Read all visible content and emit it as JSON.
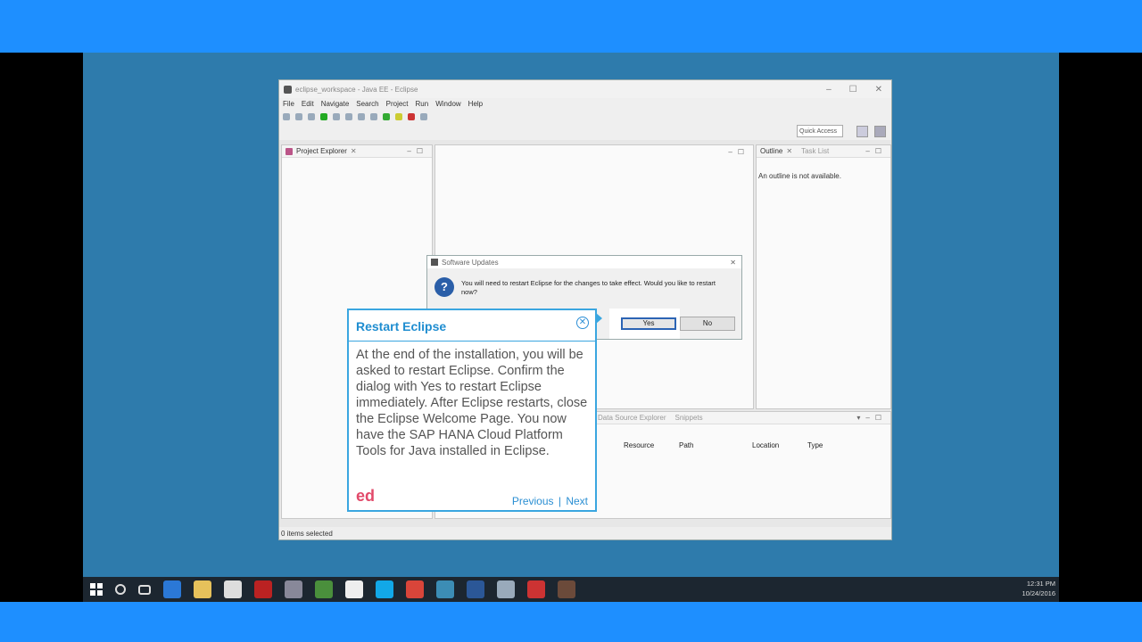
{
  "eclipse": {
    "window_title": "eclipse_workspace - Java EE - Eclipse",
    "menu": [
      "File",
      "Edit",
      "Navigate",
      "Search",
      "Project",
      "Run",
      "Window",
      "Help"
    ],
    "quick_access": "Quick Access",
    "project_explorer": "Project Explorer",
    "outline": "Outline",
    "task_list": "Task List",
    "outline_msg": "An outline is not available.",
    "bottom_tabs": [
      "Data Source Explorer",
      "Snippets"
    ],
    "table_headers": [
      "Resource",
      "Path",
      "Location",
      "Type"
    ],
    "status": "0 items selected"
  },
  "dialog": {
    "title": "Software Updates",
    "message": "You will need to restart Eclipse for the changes to take effect. Would you like to restart now?",
    "yes": "Yes",
    "no": "No"
  },
  "callout": {
    "title": "Restart Eclipse",
    "body": "At the end of the installation, you will be asked to restart Eclipse. Confirm the dialog with Yes to restart Eclipse immediately. After Eclipse restarts, close the Eclipse Welcome Page. You now have the SAP HANA Cloud Platform Tools for Java installed in Eclipse.",
    "previous": "Previous",
    "separator": "|",
    "next": "Next",
    "logo": "ed"
  },
  "taskbar": {
    "time": "12:31 PM",
    "date": "10/24/2016",
    "icons": [
      "windows-start-icon",
      "cortana-icon",
      "task-view-icon",
      "edge-icon",
      "file-explorer-icon",
      "store-icon",
      "filezilla-icon",
      "app-icon",
      "chrome-icon",
      "app2-icon",
      "skype-icon",
      "chrome2-icon",
      "app3-icon",
      "word-icon",
      "app4-icon",
      "chrome3-icon",
      "eclipse-icon"
    ]
  }
}
